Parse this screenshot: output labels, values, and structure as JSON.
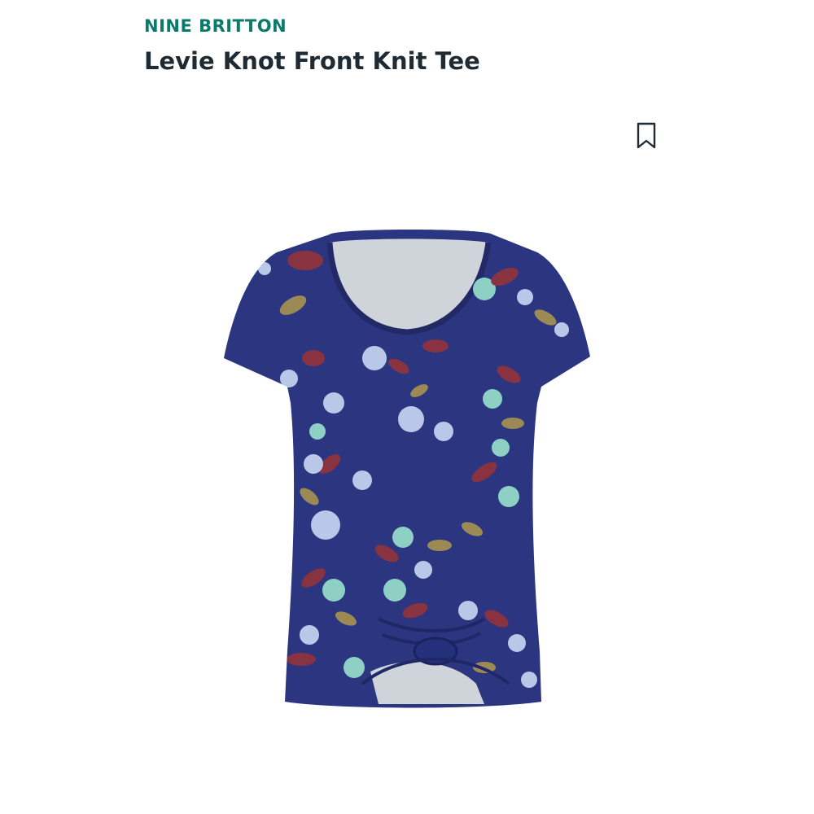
{
  "product": {
    "brand": "NINE BRITTON",
    "name": "Levie Knot Front Knit Tee"
  },
  "icons": {
    "save": "bookmark-icon"
  },
  "colors": {
    "brand": "#0a7a6b",
    "title": "#1f2a33",
    "garment_base": "#2b3580",
    "garment_lining": "#cfd3da",
    "flower_maroon": "#8a3340",
    "flower_pale_blue": "#b9c7e8",
    "flower_mint": "#8ed1c4",
    "leaf_olive": "#9c8a55"
  }
}
